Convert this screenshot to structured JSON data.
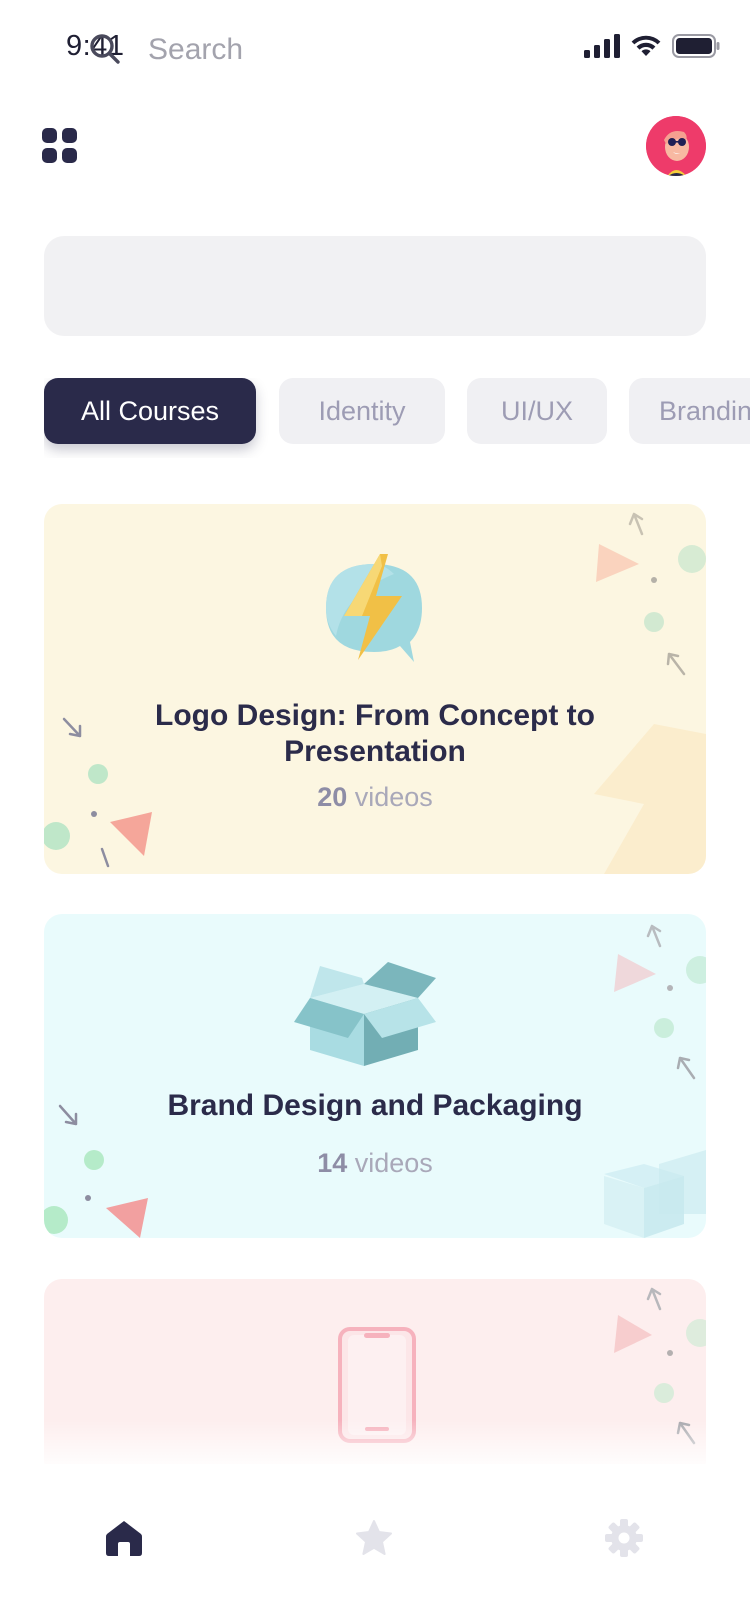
{
  "status_bar": {
    "time": "9:41",
    "icons": [
      "cellular-signal-icon",
      "wifi-icon",
      "battery-icon"
    ]
  },
  "header": {
    "menu_icon": "grid-menu-icon",
    "avatar": "user-avatar"
  },
  "search": {
    "placeholder": "Search",
    "value": ""
  },
  "filters": {
    "chips": [
      {
        "label": "All Courses",
        "active": true
      },
      {
        "label": "Identity",
        "active": false
      },
      {
        "label": "UI/UX",
        "active": false
      },
      {
        "label": "Branding",
        "active": false
      }
    ]
  },
  "courses": [
    {
      "title": "Logo Design: From Concept to Presentation",
      "video_count": "20",
      "videos_label": "videos",
      "icon": "lightning-bubble-icon",
      "background": "#fcf6e1"
    },
    {
      "title": "Brand Design and Packaging",
      "video_count": "14",
      "videos_label": "videos",
      "icon": "open-box-icon",
      "background": "#e9fbfc"
    },
    {
      "title": "",
      "icon": "smartphone-icon",
      "background": "#fdeeee"
    }
  ],
  "tab_bar": {
    "tabs": [
      {
        "name": "home",
        "icon": "home-icon",
        "active": true
      },
      {
        "name": "favorites",
        "icon": "star-icon",
        "active": false
      },
      {
        "name": "settings",
        "icon": "gear-icon",
        "active": false
      }
    ]
  },
  "colors": {
    "primary_dark": "#2a2a4a",
    "chip_inactive_bg": "#f0f0f3",
    "chip_inactive_text": "#9d9cb4",
    "search_bg": "#f1f1f3",
    "avatar_bg": "#ee3b6a",
    "tab_inactive": "#e3e3ea"
  }
}
